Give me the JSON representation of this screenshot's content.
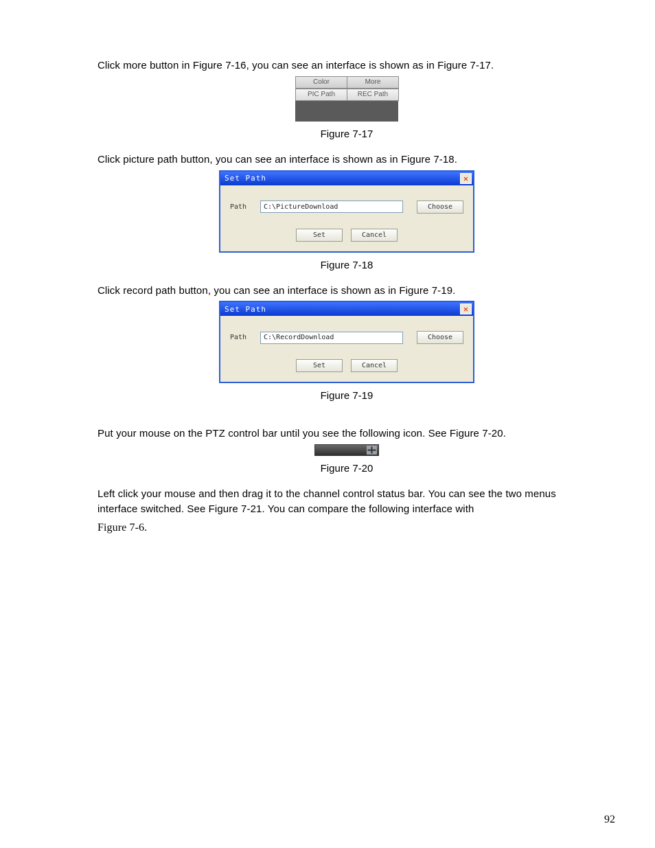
{
  "para1": "Click more button in Figure 7-16, you can see an interface is shown as in Figure 7-17.",
  "fig17": {
    "r1c1": "Color",
    "r1c2": "More",
    "r2c1": "PIC Path",
    "r2c2": "REC Path",
    "caption": "Figure 7-17"
  },
  "para2": "Click picture path button, you can see an interface is shown as in Figure 7-18.",
  "dlg18": {
    "title": "Set Path",
    "close": "✕",
    "pathlabel": "Path",
    "pathvalue": "C:\\PictureDownload",
    "choose": "Choose",
    "set": "Set",
    "cancel": "Cancel",
    "caption": "Figure 7-18"
  },
  "para3": "Click record path button, you can see an interface is shown as in Figure 7-19.",
  "dlg19": {
    "title": "Set Path",
    "close": "✕",
    "pathlabel": "Path",
    "pathvalue": "C:\\RecordDownload",
    "choose": "Choose",
    "set": "Set",
    "cancel": "Cancel",
    "caption": "Figure 7-19"
  },
  "para4": "Put your mouse on the PTZ control bar until you see the following icon. See Figure 7-20.",
  "fig20caption": "Figure 7-20",
  "para5": "Left click your mouse and then drag it to the channel control status bar. You can see the two menus interface switched. See Figure 7-21. You can compare the following interface with",
  "para6": "Figure 7-6.",
  "pageno": "92"
}
